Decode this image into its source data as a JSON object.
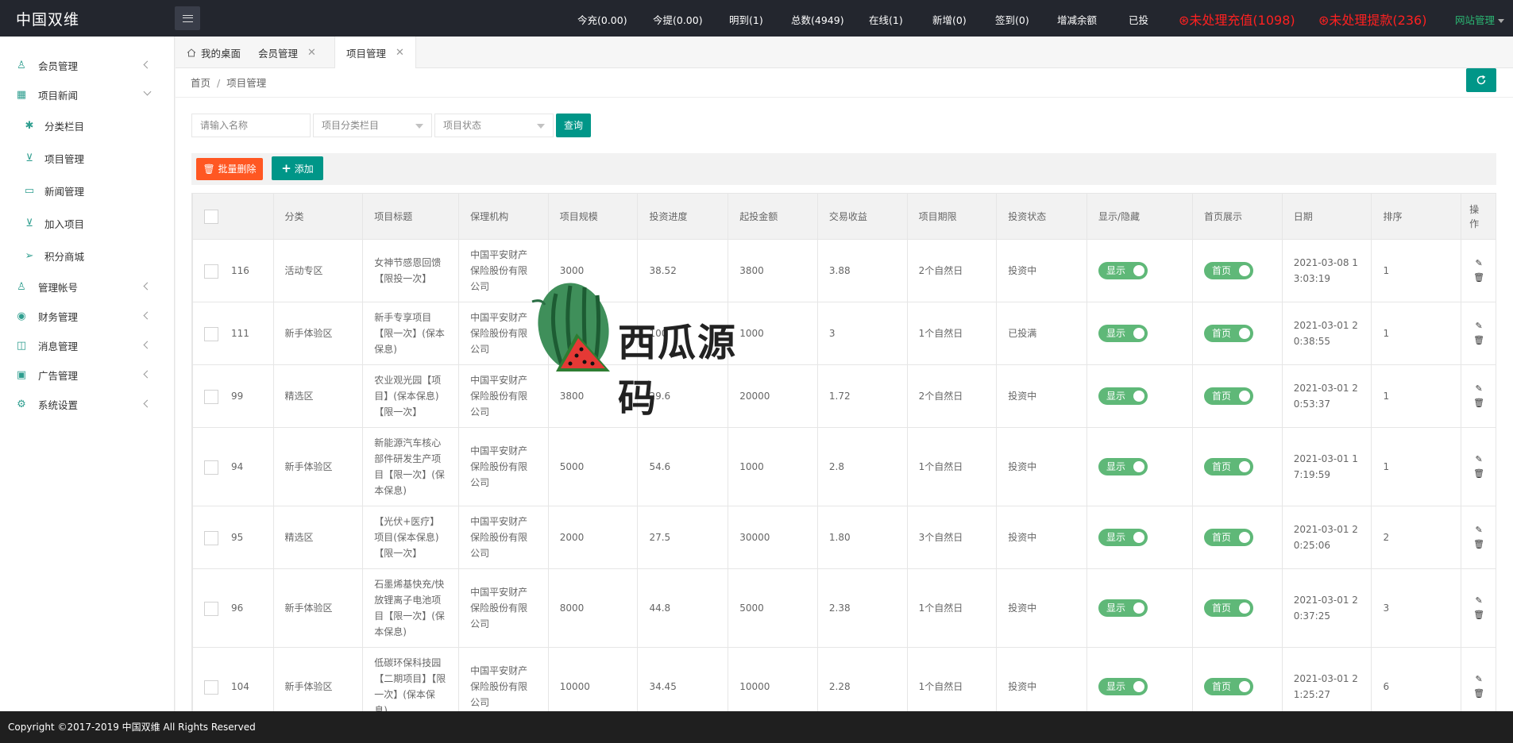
{
  "app": {
    "title": "中国双维"
  },
  "topbar": {
    "stats": [
      {
        "label": "今充(0.00)"
      },
      {
        "label": "今提(0.00)"
      },
      {
        "label": "明到(1)"
      },
      {
        "label": "总数(4949)"
      },
      {
        "label": "在线(1)"
      },
      {
        "label": "新增(0)"
      },
      {
        "label": "签到(0)"
      },
      {
        "label": "增减余额"
      },
      {
        "label": "已投"
      }
    ],
    "alerts": [
      {
        "label": "未处理充值(1098)"
      },
      {
        "label": "未处理提款(236)"
      }
    ],
    "site_manage": "网站管理"
  },
  "sidebar": {
    "items": [
      {
        "label": "会员管理",
        "icon": "user-icon"
      },
      {
        "label": "项目新闻",
        "icon": "book-icon"
      },
      {
        "label": "分类栏目",
        "icon": "category-icon"
      },
      {
        "label": "项目管理",
        "icon": "cart-icon"
      },
      {
        "label": "新闻管理",
        "icon": "doc-icon"
      },
      {
        "label": "加入项目",
        "icon": "cart-icon"
      },
      {
        "label": "积分商城",
        "icon": "send-icon"
      },
      {
        "label": "管理帐号",
        "icon": "users-icon"
      },
      {
        "label": "财务管理",
        "icon": "money-icon"
      },
      {
        "label": "消息管理",
        "icon": "chat-icon"
      },
      {
        "label": "广告管理",
        "icon": "image-icon"
      },
      {
        "label": "系统设置",
        "icon": "gear-icon"
      }
    ]
  },
  "tabs": [
    {
      "label": "我的桌面"
    },
    {
      "label": "会员管理"
    },
    {
      "label": "项目管理"
    }
  ],
  "breadcrumb": {
    "home": "首页",
    "current": "项目管理"
  },
  "filters": {
    "name_placeholder": "请输入名称",
    "category": "项目分类栏目",
    "status": "项目状态",
    "query": "查询"
  },
  "toolbar": {
    "batch_delete": "批量删除",
    "add": "添加"
  },
  "table": {
    "headers": [
      "分类",
      "项目标题",
      "保理机构",
      "项目规模",
      "投资进度",
      "起投金额",
      "交易收益",
      "项目期限",
      "投资状态",
      "显示/隐藏",
      "首页展示",
      "日期",
      "排序",
      "操作"
    ],
    "rows": [
      {
        "id": "116",
        "category": "活动专区",
        "title": "女神节感恩回馈【限投一次】",
        "org": "中国平安财产保险股份有限公司",
        "scale": "3000",
        "progress": "38.52",
        "min": "3800",
        "yield": "3.88",
        "term": "2个自然日",
        "status": "投资中",
        "show": "显示",
        "home": "首页",
        "date": "2021-03-08 13:03:19",
        "sort": "1"
      },
      {
        "id": "111",
        "category": "新手体验区",
        "title": "新手专享项目【限一次】(保本保息)",
        "org": "中国平安财产保险股份有限公司",
        "scale": "2000",
        "progress": "100",
        "min": "1000",
        "yield": "3",
        "term": "1个自然日",
        "status": "已投满",
        "show": "显示",
        "home": "首页",
        "date": "2021-03-01 20:38:55",
        "sort": "1"
      },
      {
        "id": "99",
        "category": "精选区",
        "title": "农业观光园【项目】(保本保息)【限一次】",
        "org": "中国平安财产保险股份有限公司",
        "scale": "3800",
        "progress": "29.6",
        "min": "20000",
        "yield": "1.72",
        "term": "2个自然日",
        "status": "投资中",
        "show": "显示",
        "home": "首页",
        "date": "2021-03-01 20:53:37",
        "sort": "1"
      },
      {
        "id": "94",
        "category": "新手体验区",
        "title": "新能源汽车核心部件研发生产项目【限一次】(保本保息)",
        "org": "中国平安财产保险股份有限公司",
        "scale": "5000",
        "progress": "54.6",
        "min": "1000",
        "yield": "2.8",
        "term": "1个自然日",
        "status": "投资中",
        "show": "显示",
        "home": "首页",
        "date": "2021-03-01 17:19:59",
        "sort": "1"
      },
      {
        "id": "95",
        "category": "精选区",
        "title": "【光伏+医疗】项目(保本保息)【限一次】",
        "org": "中国平安财产保险股份有限公司",
        "scale": "2000",
        "progress": "27.5",
        "min": "30000",
        "yield": "1.80",
        "term": "3个自然日",
        "status": "投资中",
        "show": "显示",
        "home": "首页",
        "date": "2021-03-01 20:25:06",
        "sort": "2"
      },
      {
        "id": "96",
        "category": "新手体验区",
        "title": "石墨烯基快充/快放锂离子电池项目【限一次】(保本保息)",
        "org": "中国平安财产保险股份有限公司",
        "scale": "8000",
        "progress": "44.8",
        "min": "5000",
        "yield": "2.38",
        "term": "1个自然日",
        "status": "投资中",
        "show": "显示",
        "home": "首页",
        "date": "2021-03-01 20:37:25",
        "sort": "3"
      },
      {
        "id": "104",
        "category": "新手体验区",
        "title": "低碳环保科技园【二期项目】【限一次】(保本保息)",
        "org": "中国平安财产保险股份有限公司",
        "scale": "10000",
        "progress": "34.45",
        "min": "10000",
        "yield": "2.28",
        "term": "1个自然日",
        "status": "投资中",
        "show": "显示",
        "home": "首页",
        "date": "2021-03-01 21:25:27",
        "sort": "6"
      }
    ]
  },
  "watermark": {
    "text": "西瓜源码"
  },
  "footer": {
    "copyright": "Copyright ©2017-2019 中国双维 All Rights Reserved"
  },
  "colors": {
    "primary": "#009688",
    "danger": "#ff5722",
    "switch": "#5fb878",
    "alert": "#ff2020",
    "header": "#23262e",
    "footer": "#1f1f1f"
  }
}
